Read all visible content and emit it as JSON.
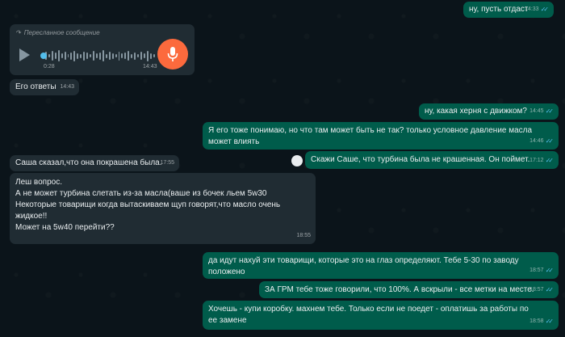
{
  "messages": [
    {
      "id": "m1",
      "text": "ну, пусть отдаст",
      "time": "14:33"
    },
    {
      "id": "m2",
      "forward_label": "Пересланное сообщение",
      "elapsed": "0:28",
      "time": "14:43"
    },
    {
      "id": "m3",
      "text": "Его ответы",
      "time": "14:43"
    },
    {
      "id": "m4",
      "text": "ну, какая херня с движком?",
      "time": "14:45"
    },
    {
      "id": "m5",
      "text": "Я его тоже понимаю, но что там может быть не так? только условное давление масла может влиять",
      "time": "14:46"
    },
    {
      "id": "m6",
      "text": "Скажи Саше, что турбина была не крашенная. Он поймет.",
      "time": "17:12"
    },
    {
      "id": "m7",
      "text": "Саша сказал,что она покрашена была.",
      "time": "17:55"
    },
    {
      "id": "m8",
      "text": "Леш вопрос.\nА не может турбина слетать из-за масла(ваше из бочек льем 5w30\nНекоторые товарищи когда вытаскиваем щуп говорят,что масло очень жидкое!!\nМожет на 5w40 перейти??",
      "time": "18:55"
    },
    {
      "id": "m9",
      "text": "да идут нахуй эти товарищи, которые это на глаз определяют. Тебе 5-30 по заводу положено",
      "time": "18:57"
    },
    {
      "id": "m10",
      "text": "ЗА ГРМ тебе тоже говорили, что 100%. А вскрыли - все метки на месте.",
      "time": "18:57"
    },
    {
      "id": "m11",
      "text": "Хочешь - купи коробку. махнем тебе. Только если не поедет - оплатишь за работы по ее замене",
      "time": "18:58"
    }
  ],
  "icons": {
    "ticks": "✓✓"
  },
  "colors": {
    "outgoing": "#005c4b",
    "incoming": "#202c33",
    "mic": "#fc6a3d",
    "read_ticks": "#53bdeb"
  }
}
